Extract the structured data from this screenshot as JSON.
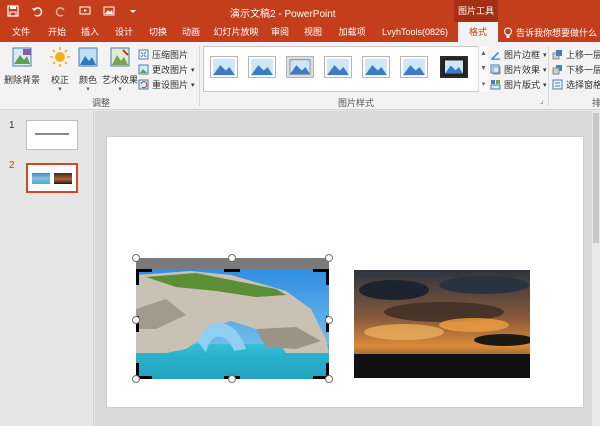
{
  "titlebar": {
    "qat": [
      {
        "name": "save-icon",
        "glyph": "💾"
      },
      {
        "name": "undo-icon",
        "glyph": "↶"
      },
      {
        "name": "redo-icon",
        "glyph": "↻"
      },
      {
        "name": "pin-icon",
        "glyph": "✔"
      },
      {
        "name": "image-icon",
        "glyph": "▣"
      },
      {
        "name": "customize-icon",
        "glyph": "▾"
      }
    ],
    "document_title": "演示文稿2  -  PowerPoint",
    "tool_group": "图片工具"
  },
  "tabs": [
    {
      "label": "文件"
    },
    {
      "label": "开始"
    },
    {
      "label": "插入"
    },
    {
      "label": "设计"
    },
    {
      "label": "切换"
    },
    {
      "label": "动画"
    },
    {
      "label": "幻灯片放映"
    },
    {
      "label": "审阅"
    },
    {
      "label": "视图"
    },
    {
      "label": "加载项"
    },
    {
      "label": "LvyhTools(0826)"
    },
    {
      "label": "格式"
    }
  ],
  "tellme": "告诉我你想要做什么",
  "ribbon": {
    "remove_bg": "删除背景",
    "corrections": "校正",
    "color": "颜色",
    "artistic": "艺术效果",
    "compress": "压缩图片",
    "change": "更改图片",
    "reset": "重设图片",
    "adjust_group": "调整",
    "styles_group": "图片样式",
    "border": "图片边框",
    "effects": "图片效果",
    "layout": "图片版式",
    "bring_forward": "上移一层",
    "send_backward": "下移一层",
    "selection_pane": "选择窗格",
    "arrange_group": "排"
  },
  "slides": [
    {
      "number": "1"
    },
    {
      "number": "2"
    }
  ],
  "colors": {
    "accent": "#c43e1c",
    "active_tab_text": "#c43e1c",
    "thumb_selected": "#d24726"
  }
}
